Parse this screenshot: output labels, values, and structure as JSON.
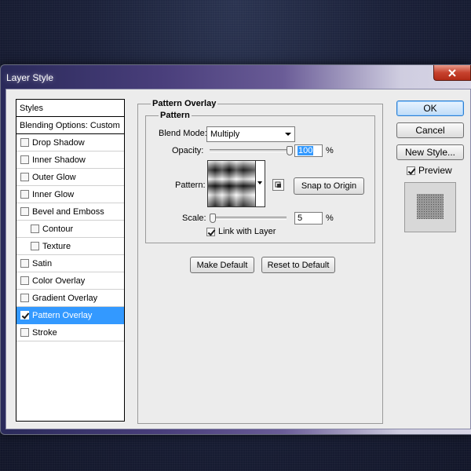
{
  "window": {
    "title": "Layer Style"
  },
  "styles_panel": {
    "header": "Styles",
    "blending_options": "Blending Options: Custom",
    "items": [
      {
        "label": "Drop Shadow",
        "checked": false,
        "sub": false,
        "selected": false
      },
      {
        "label": "Inner Shadow",
        "checked": false,
        "sub": false,
        "selected": false
      },
      {
        "label": "Outer Glow",
        "checked": false,
        "sub": false,
        "selected": false
      },
      {
        "label": "Inner Glow",
        "checked": false,
        "sub": false,
        "selected": false
      },
      {
        "label": "Bevel and Emboss",
        "checked": false,
        "sub": false,
        "selected": false
      },
      {
        "label": "Contour",
        "checked": false,
        "sub": true,
        "selected": false
      },
      {
        "label": "Texture",
        "checked": false,
        "sub": true,
        "selected": false
      },
      {
        "label": "Satin",
        "checked": false,
        "sub": false,
        "selected": false
      },
      {
        "label": "Color Overlay",
        "checked": false,
        "sub": false,
        "selected": false
      },
      {
        "label": "Gradient Overlay",
        "checked": false,
        "sub": false,
        "selected": false
      },
      {
        "label": "Pattern Overlay",
        "checked": true,
        "sub": false,
        "selected": true
      },
      {
        "label": "Stroke",
        "checked": false,
        "sub": false,
        "selected": false
      }
    ]
  },
  "pattern_overlay": {
    "section_title": "Pattern Overlay",
    "group_title": "Pattern",
    "blend_mode_label": "Blend Mode:",
    "blend_mode_value": "Multiply",
    "opacity_label": "Opacity:",
    "opacity_value": "100",
    "opacity_fraction": 1.0,
    "percent": "%",
    "pattern_label": "Pattern:",
    "snap_button": "Snap to Origin",
    "scale_label": "Scale:",
    "scale_value": "5",
    "scale_fraction": 0.0,
    "link_label": "Link with Layer",
    "link_checked": true,
    "make_default": "Make Default",
    "reset_default": "Reset to Default"
  },
  "buttons": {
    "ok": "OK",
    "cancel": "Cancel",
    "new_style": "New Style...",
    "preview_label": "Preview",
    "preview_checked": true
  },
  "colors": {
    "selection": "#3399ff",
    "close_button": "#c7422e"
  }
}
